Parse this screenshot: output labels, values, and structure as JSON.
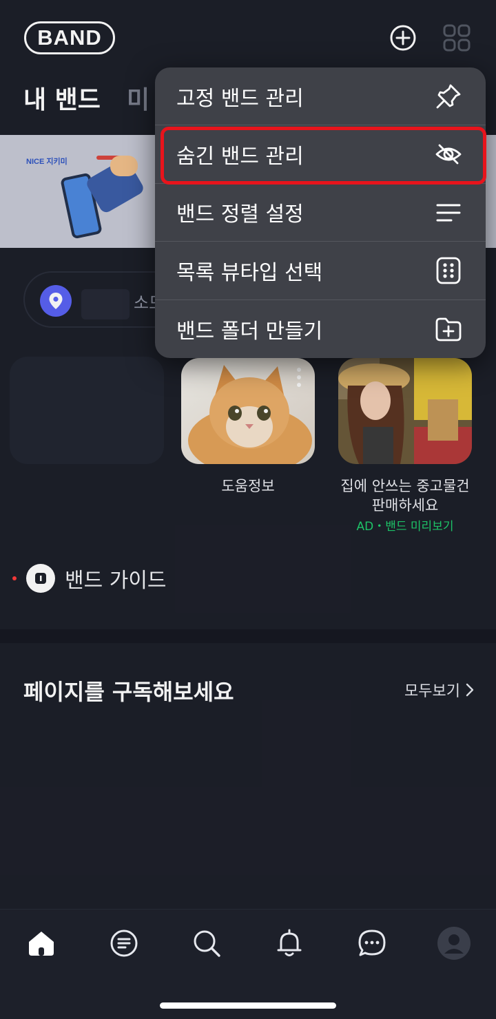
{
  "header": {
    "logo": "BAND",
    "tabs": [
      {
        "label": "내 밴드"
      },
      {
        "label": "미"
      }
    ]
  },
  "banner": {
    "brand": "NICE 지키미"
  },
  "location": {
    "text": "소모"
  },
  "bands": [
    {
      "name": "도움정보"
    },
    {
      "name": "집에 안쓰는 중고물건 판매하세요",
      "tag": "AD・밴드 미리보기"
    }
  ],
  "guide": {
    "label": "밴드 가이드"
  },
  "pages_section": {
    "title": "페이지를 구독해보세요",
    "see_all": "모두보기"
  },
  "menu": {
    "items": [
      {
        "label": "고정 밴드 관리",
        "icon": "pin-icon"
      },
      {
        "label": "숨긴 밴드 관리",
        "icon": "eye-off-icon"
      },
      {
        "label": "밴드 정렬 설정",
        "icon": "sort-lines-icon"
      },
      {
        "label": "목록 뷰타입 선택",
        "icon": "grid-dots-icon"
      },
      {
        "label": "밴드 폴더 만들기",
        "icon": "folder-plus-icon"
      }
    ],
    "highlighted_index": 1,
    "highlight_color": "#e8141c"
  },
  "bottom_nav": {
    "items": [
      "home-icon",
      "feed-icon",
      "search-icon",
      "bell-icon",
      "chat-icon",
      "profile-icon"
    ]
  },
  "colors": {
    "background": "#1d202a",
    "menu_background": "#3f4148",
    "ad_green": "#1fce6d",
    "location_pin": "#5a63f4"
  }
}
